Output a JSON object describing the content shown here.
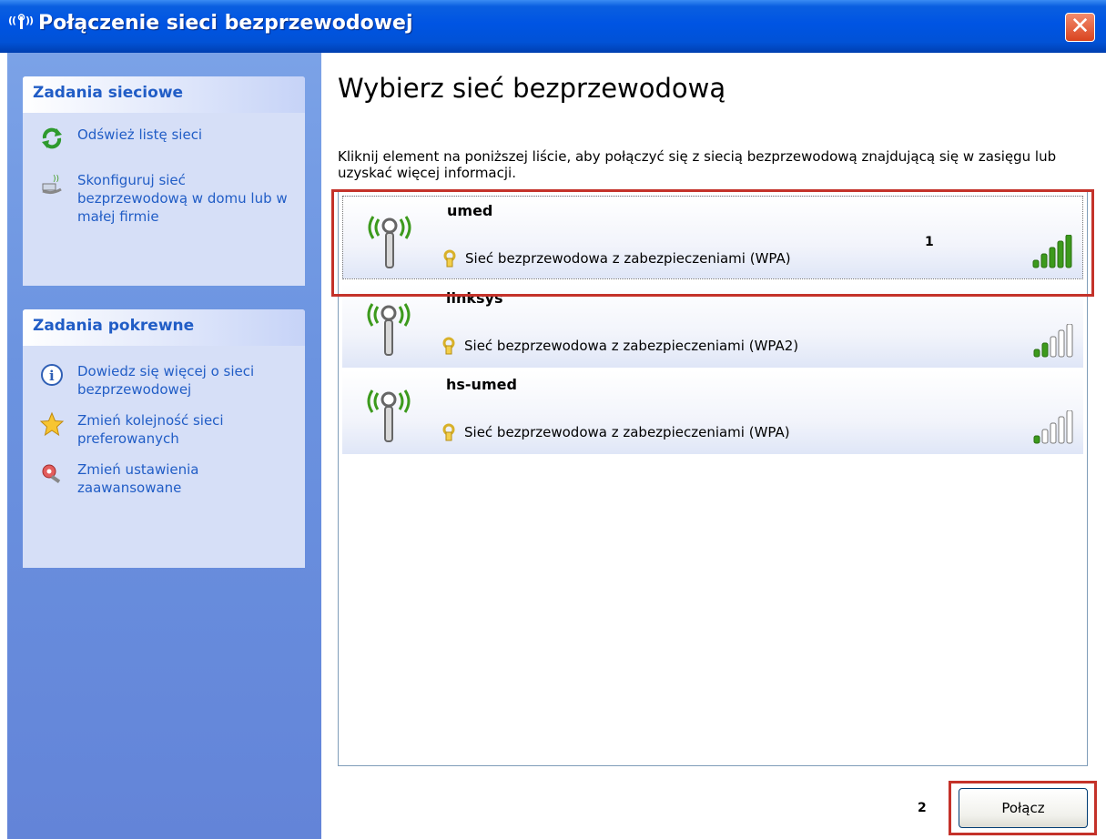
{
  "window": {
    "title": "Połączenie sieci bezprzewodowej",
    "close_label": "✕"
  },
  "network_tasks": {
    "header": "Zadania sieciowe",
    "items": [
      {
        "label": "Odśwież listę sieci",
        "icon": "refresh-icon"
      },
      {
        "label": "Skonfiguruj sieć bezprzewodową w domu lub w małej firmie",
        "icon": "wireless-setup-icon"
      }
    ]
  },
  "related_tasks": {
    "header": "Zadania pokrewne",
    "items": [
      {
        "label": "Dowiedz się więcej o sieci bezprzewodowej",
        "icon": "info-icon"
      },
      {
        "label": "Zmień kolejność sieci preferowanych",
        "icon": "star-icon"
      },
      {
        "label": "Zmień ustawienia zaawansowane",
        "icon": "settings-icon"
      }
    ]
  },
  "main": {
    "heading": "Wybierz sieć bezprzewodową",
    "description": "Kliknij element na poniższej liście, aby połączyć się z siecią bezprzewodową znajdującą się w zasięgu lub uzyskać więcej informacji."
  },
  "networks": [
    {
      "ssid": "umed",
      "security": "Sieć bezprzewodowa z zabezpieczeniami (WPA)",
      "signal_bars": 5,
      "selected": true
    },
    {
      "ssid": "linksys",
      "security": "Sieć bezprzewodowa z zabezpieczeniami (WPA2)",
      "signal_bars": 2,
      "selected": false
    },
    {
      "ssid": "hs-umed",
      "security": "Sieć bezprzewodowa z zabezpieczeniami (WPA)",
      "signal_bars": 1,
      "selected": false
    }
  ],
  "annotations": {
    "marker1": "1",
    "marker2": "2"
  },
  "footer": {
    "connect_label": "Połącz"
  },
  "colors": {
    "accent": "#0054e3",
    "task_link": "#215dc6",
    "highlight": "#c4322a",
    "signal_on": "#3c9a1c"
  }
}
